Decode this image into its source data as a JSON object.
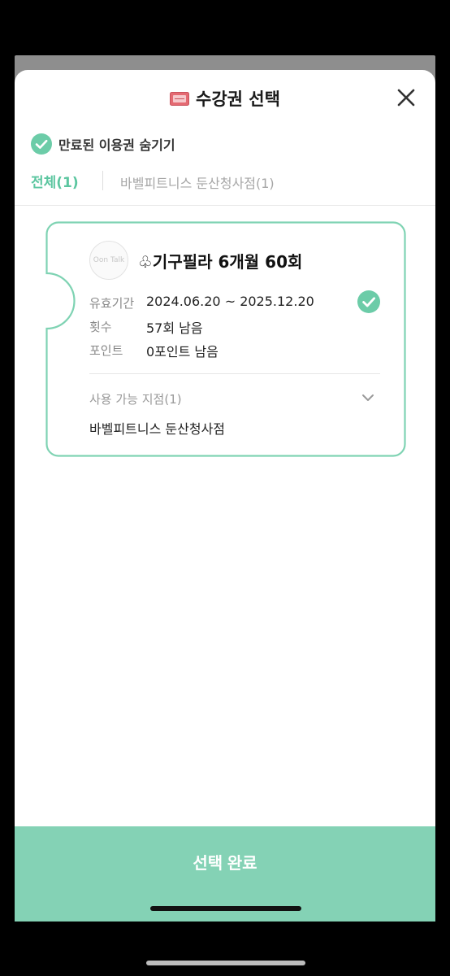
{
  "header": {
    "title": "수강권 선택",
    "ticket_icon": "ticket-icon",
    "close_icon": "close-icon"
  },
  "filter": {
    "hide_expired_label": "만료된 이용권 숨기기",
    "checked": true
  },
  "tabs": [
    {
      "label": "전체(1)",
      "active": true
    },
    {
      "label": "바벨피트니스 둔산청사점(1)",
      "active": false
    }
  ],
  "pass": {
    "logo_text": "Oon Talk",
    "title": "♧기구필라 6개월 60회",
    "rows": [
      {
        "label": "유효기간",
        "value": "2024.06.20 ~ 2025.12.20"
      },
      {
        "label": "횟수",
        "value": "57회 남음"
      },
      {
        "label": "포인트",
        "value": "0포인트 남음"
      }
    ],
    "selected": true,
    "branches_label": "사용 가능 지점(1)",
    "branch_name": "바벨피트니스 둔산청사점"
  },
  "confirm_label": "선택 완료",
  "colors": {
    "accent": "#5cc6a0",
    "confirm_bg": "#84d2b5",
    "card_border": "#7fd3b3"
  }
}
